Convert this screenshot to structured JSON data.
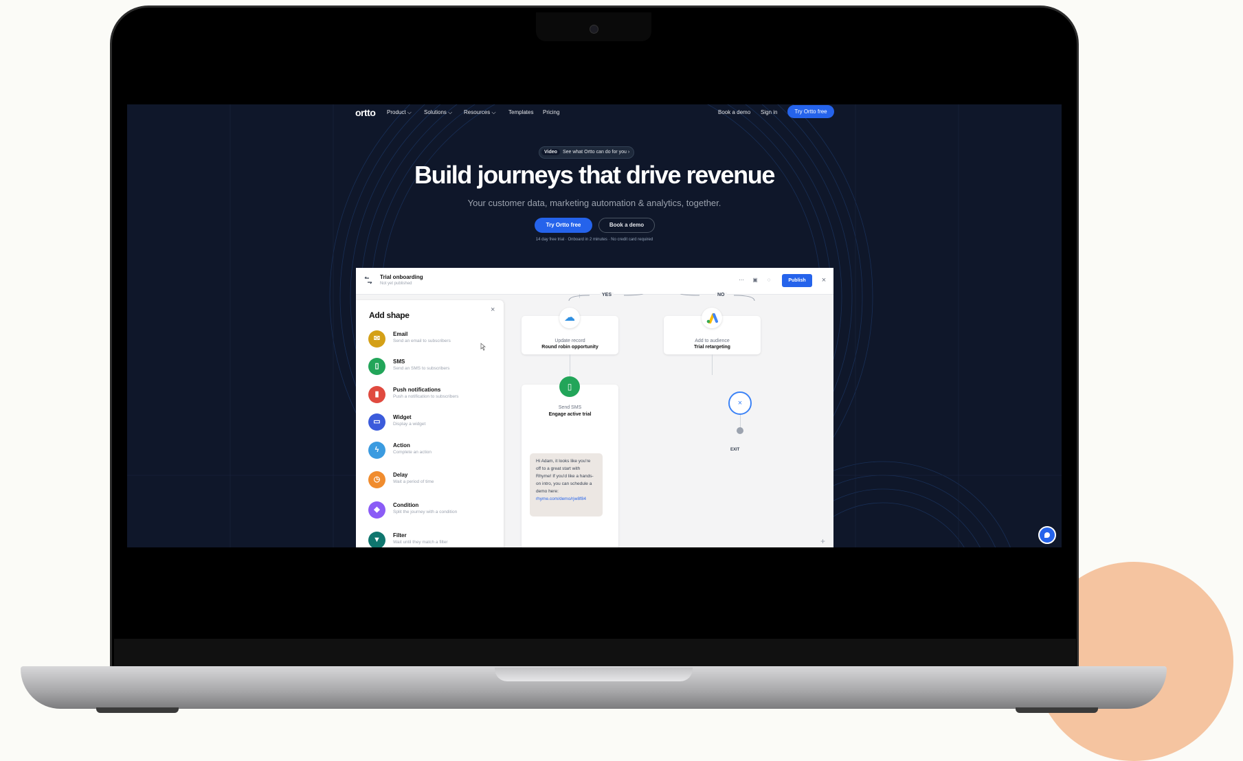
{
  "nav": {
    "logo": "ortto",
    "items": [
      "Product ⌵",
      "Solutions ⌵",
      "Resources ⌵",
      "Templates",
      "Pricing"
    ],
    "book_demo": "Book a demo",
    "sign_in": "Sign in",
    "cta": "Try Ortto free"
  },
  "hero": {
    "pill_tag": "Video",
    "pill_text": "See what Ortto can do for you ›",
    "headline": "Build journeys that drive revenue",
    "subhead": "Your customer data, marketing automation & analytics, together.",
    "primary_cta": "Try Ortto free",
    "secondary_cta": "Book a demo",
    "fine_print": "14 day free trial · Onboard in 2 minutes · No credit card required"
  },
  "app": {
    "title": "Trial onboarding",
    "subtitle": "Not yet published",
    "publish": "Publish",
    "panel_title": "Add shape",
    "shapes": [
      {
        "name": "Email",
        "desc": "Send an email to subscribers",
        "color": "#d4a017",
        "icon": "✉"
      },
      {
        "name": "SMS",
        "desc": "Send an SMS to subscribers",
        "color": "#22a559",
        "icon": "▯"
      },
      {
        "name": "Push notifications",
        "desc": "Push a notification to subscribers",
        "color": "#e04a3f",
        "icon": "▮"
      },
      {
        "name": "Widget",
        "desc": "Display a widget",
        "color": "#3b5bdb",
        "icon": "▭"
      },
      {
        "name": "Action",
        "desc": "Complete an action",
        "color": "#3b9be0",
        "icon": "ϟ"
      },
      {
        "name": "Delay",
        "desc": "Wait a period of time",
        "color": "#f08c2e",
        "icon": "◷"
      },
      {
        "name": "Condition",
        "desc": "Split the journey with a condition",
        "color": "#8b5cf6",
        "icon": "◆"
      },
      {
        "name": "Filter",
        "desc": "Wait until they match a filter",
        "color": "#0f766e",
        "icon": "▼"
      }
    ],
    "branch_yes": "YES",
    "branch_no": "NO",
    "node_update_line1": "Update record",
    "node_update_line2": "Round robin opportunity",
    "node_audience_line1": "Add to audience",
    "node_audience_line2": "Trial retargeting",
    "node_sms_line1": "Send SMS",
    "node_sms_line2": "Engage active trial",
    "sms_body": "Hi Adam, it looks like you're off to a great start with Rhyme! If you'd like a hands-on intro, you can schedule a demo here: ",
    "sms_link": "rhyme.com/demo/rjw8f84",
    "exit_label": "EXIT",
    "close_glyph": "×",
    "plus_glyph": "+"
  },
  "colors": {
    "accent": "#2563eb",
    "screen_bg": "#0f172a",
    "blob": "#f5c4a0"
  }
}
